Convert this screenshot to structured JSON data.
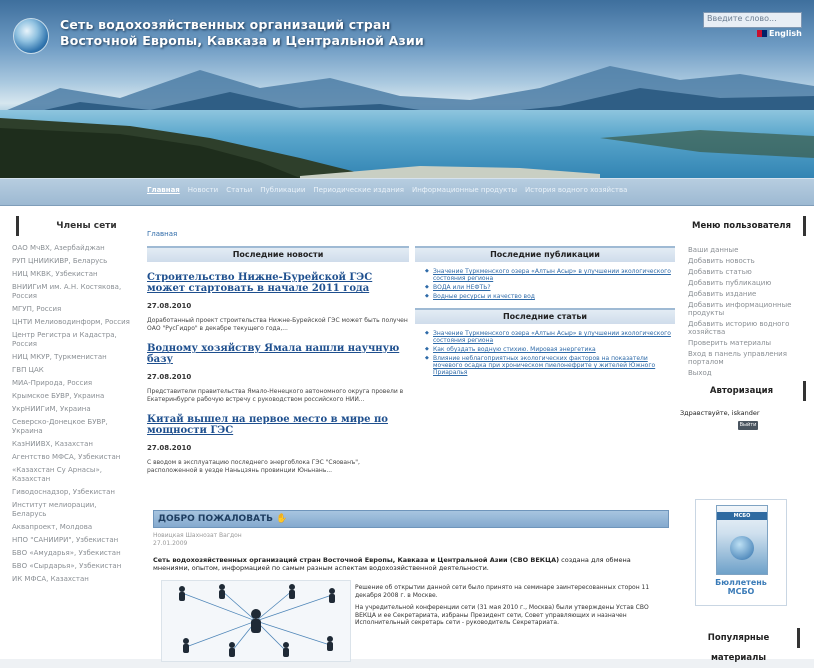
{
  "header": {
    "title_line1": "Сеть водохозяйственных организаций стран",
    "title_line2": "Восточной Европы, Кавказа и Центральной Азии",
    "search_placeholder": "Введите слово...",
    "lang_label": "English"
  },
  "nav": {
    "items": [
      "Главная",
      "Новости",
      "Статьи",
      "Публикации",
      "Периодические издания",
      "Информационные продукты",
      "История водного хозяйства"
    ],
    "active_index": 0
  },
  "left_sidebar": {
    "title": "Члены сети",
    "members": [
      "ОАО МчВХ, Азербайджан",
      "РУП ЦНИИКИВР, Беларусь",
      "НИЦ МКВК, Узбекистан",
      "ВНИИГиМ им. А.Н. Костякова, Россия",
      "МГУП, Россия",
      "ЦНТИ Мелиоводинформ, Россия",
      "Центр Регистра и Кадастра, Россия",
      "НИЦ МКУР, Туркменистан",
      "ГВП ЦАК",
      "МИА-Природа, Россия",
      "Крымское БУВР, Украина",
      "УкрНИИГиМ, Украина",
      "Северско-Донецкое БУВР, Украина",
      "КазНИИВХ, Казахстан",
      "Агентство МФСА, Узбекистан",
      "«Казахстан Су Арнасы», Казахстан",
      "Гиводоснадзор, Узбекистан",
      "Институт мелиорации, Беларусь",
      "Аквапроект, Молдова",
      "НПО \"САНИИРИ\", Узбекистан",
      "БВО «Амударья», Узбекистан",
      "БВО «Сырдарья», Узбекистан",
      "ИК МФСА, Казахстан"
    ]
  },
  "main": {
    "breadcrumb": "Главная",
    "news": {
      "heading": "Последние новости",
      "items": [
        {
          "title": "Строительство Нижне-Бурейской ГЭС может стартовать в начале 2011 года",
          "date": "27.08.2010",
          "text": "Доработанный проект строительства Нижне-Бурейской ГЭС может быть получен ОАО \"РусГидро\" в декабре текущего года,..."
        },
        {
          "title": "Водному хозяйству Ямала нашли научную базу",
          "date": "27.08.2010",
          "text": "Представители правительства Ямало-Ненецкого автономного округа провели в Екатеринбурге рабочую встречу с руководством российского НИИ..."
        },
        {
          "title": "Китай вышел на первое место в мире по мощности ГЭС",
          "date": "27.08.2010",
          "text": "С вводом в эксплуатацию последнего энергоблока ГЭС \"Сяованъ\", расположенной в уезде Наньцзянь провинции Юньнань..."
        }
      ]
    },
    "publications": {
      "heading": "Последние публикации",
      "items": [
        "Значение Туркменского озера «Алтын Асыр» в улучшении экологического состояния региона",
        "ВОДА или НЕФТЬ?",
        "Водные ресурсы и качество вод"
      ]
    },
    "articles": {
      "heading": "Последние статьи",
      "items": [
        "Значение Туркменского озера «Алтын Асыр» в улучшении экологического состояния региона",
        "Как обуздать водную стихию. Мировая энергетика",
        "Влияние неблагоприятных экологических факторов на показатели мочевого осадка при хроническом пиелонефрите у жителей Южного Приаралья"
      ]
    },
    "welcome": {
      "heading": "ДОБРО ПОЖАЛОВАТЬ",
      "author": "Новицкая Шахнозат Вагдон",
      "date": "27.01.2009",
      "lead_bold": "Сеть водохозяйственных организаций стран Восточной Европы, Кавказа и Центральной Азии (СВО ВЕКЦА)",
      "lead_rest": " создана для обмена мнениями, опытом, информацией по самым разным аспектам водохозяйственной деятельности.",
      "para1": "Решение об открытии данной сети было принято на семинаре заинтересованных сторон 11 декабря 2008 г. в Москве.",
      "para2": "На учредительной конференции сети (31 мая 2010 г., Москва) были утверждены Устав СВО ВЕКЦА и ее Секретариата, избраны Президент сети, Совет управляющих и назначен Исполнительный секретарь сети - руководитель Секретариата."
    }
  },
  "right_sidebar": {
    "menu_title": "Меню пользователя",
    "menu_items": [
      "Ваши данные",
      "Добавить новость",
      "Добавить статью",
      "Добавить публикацию",
      "Добавить издание",
      "Добавить информационные продукты",
      "Добавить историю водного хозяйства",
      "Проверить материалы",
      "Вход в панель управления порталом",
      "Выход"
    ],
    "auth_title": "Авторизация",
    "greeting": "Здравствуйте, iskander",
    "exit_label": "Выйти",
    "bulletin_label_1": "Бюллетень",
    "bulletin_label_2": "МСБО",
    "cover_label": "МСБО",
    "popular_title": "Популярные материалы"
  }
}
